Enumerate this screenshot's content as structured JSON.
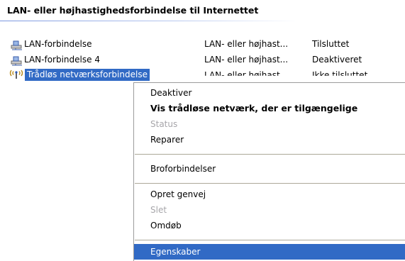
{
  "group": {
    "title": "LAN- eller højhastighedsforbindelse til Internettet"
  },
  "connections": [
    {
      "name": "LAN-forbindelse",
      "type": "LAN- eller højhast...",
      "status": "Tilsluttet",
      "icon": "lan-connection-icon"
    },
    {
      "name": "LAN-forbindelse 4",
      "type": "LAN- eller højhast...",
      "status": "Deaktiveret",
      "icon": "lan-connection-icon"
    },
    {
      "name": "Trådløs netværksforbindelse",
      "type": "LAN- eller højhast...",
      "status": "Ikke tilsluttet",
      "icon": "wireless-connection-icon"
    }
  ],
  "context_menu": {
    "items": [
      {
        "label": "Deaktiver",
        "state": "normal"
      },
      {
        "label": "Vis trådløse netværk, der er tilgængelige",
        "state": "default"
      },
      {
        "label": "Status",
        "state": "disabled"
      },
      {
        "label": "Reparer",
        "state": "normal"
      },
      {
        "label": "Broforbindelser",
        "state": "normal"
      },
      {
        "label": "Opret genvej",
        "state": "normal"
      },
      {
        "label": "Slet",
        "state": "disabled"
      },
      {
        "label": "Omdøb",
        "state": "normal"
      },
      {
        "label": "Egenskaber",
        "state": "highlighted"
      }
    ]
  },
  "colors": {
    "selection": "#316ac5",
    "disabled_text": "#a7a6aa",
    "separator": "#aca899",
    "header_rule": "#7a96df"
  }
}
